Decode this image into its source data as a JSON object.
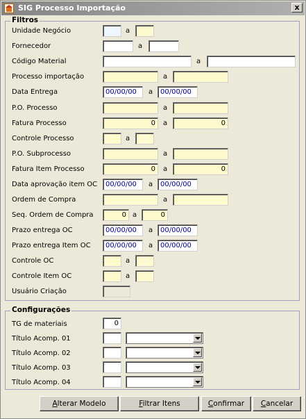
{
  "window": {
    "title": "SIG Processo Importação",
    "close": "x"
  },
  "filtros": {
    "legend": "Filtros",
    "sep": "a",
    "unidade_negocio": "Unidade Negócio",
    "fornecedor": "Fornecedor",
    "codigo_material": "Código Material",
    "processo_importacao": "Processo importação",
    "data_entrega": "Data Entrega",
    "po_processo": "P.O. Processo",
    "fatura_processo": "Fatura Processo",
    "controle_processo": "Controle Processo",
    "po_subprocesso": "P.O. Subprocesso",
    "fatura_item_processo": "Fatura Item Processo",
    "data_aprovacao": "Data aprovação item OC",
    "ordem_compra": "Ordem de Compra",
    "seq_ordem_compra": "Seq. Ordem de Compra",
    "prazo_entrega_oc": "Prazo entrega OC",
    "prazo_entrega_item_oc": "Prazo entrega Item OC",
    "controle_oc": "Controle OC",
    "controle_item_oc": "Controle Item OC",
    "usuario_criacao": "Usuário Criação",
    "date_value": "00/00/00",
    "zero": "0"
  },
  "config": {
    "legend": "Configurações",
    "tg_materiais": "TG de materiais",
    "tg_value": "0",
    "titulo1": "Título Acomp. 01",
    "titulo2": "Título Acomp. 02",
    "titulo3": "Título Acomp. 03",
    "titulo4": "Título Acomp. 04"
  },
  "buttons": {
    "alterar_u": "A",
    "alterar_rest": "lterar Modelo",
    "filtrar_u": "F",
    "filtrar_rest": "iltrar Itens",
    "confirmar_u": "C",
    "confirmar_rest": "onfirmar",
    "cancelar_u": "C",
    "cancelar_rest": "ancelar"
  }
}
